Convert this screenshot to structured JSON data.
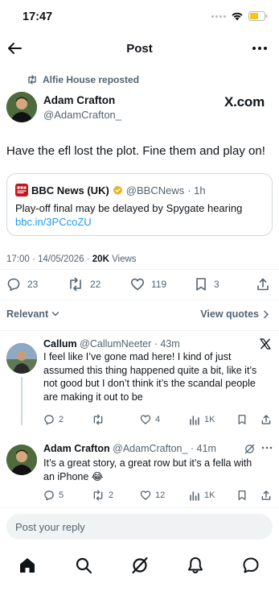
{
  "status_bar": {
    "time": "17:47"
  },
  "header": {
    "title": "Post"
  },
  "post": {
    "reposted_by": "Alfie House reposted",
    "author_name": "Adam Crafton",
    "author_handle": "@AdamCrafton_",
    "source_logo": "X.com",
    "text": "Have the efl lost the plot. Fine them and play on!",
    "quote": {
      "name": "BBC News (UK)",
      "handle": "@BBCNews",
      "time": "· 1h",
      "text": "Play-off final may be delayed by Spygate hearing",
      "link": "bbc.in/3PCcoZU"
    },
    "timestamp": "17:00 · 14/05/2026 · ",
    "views_count": "20K",
    "views_label": " Views",
    "stats": {
      "replies": "23",
      "reposts": "22",
      "likes": "119",
      "bookmarks": "3"
    }
  },
  "sort": {
    "label": "Relevant",
    "view_quotes": "View quotes"
  },
  "replies": [
    {
      "name": "Callum",
      "handle": "@CallumNeeter",
      "time": "· 43m",
      "text": "I feel like I’ve gone mad here! I kind of just assumed this thing happened quite a bit, like it’s not good but I don’t think it’s the scandal people are making it out to be",
      "replies": "2",
      "reposts": "",
      "likes": "4",
      "views": "1K"
    },
    {
      "name": "Adam Crafton",
      "handle": "@AdamCrafton_",
      "time": "· 41m",
      "text": "It’s a great story, a great row but it’s a fella with an iPhone 😂",
      "replies": "5",
      "reposts": "2",
      "likes": "12",
      "views": "1K"
    }
  ],
  "reply_bar": {
    "placeholder": "Post your reply"
  },
  "icons": [
    "back-arrow-icon",
    "more-icon",
    "repost-icon",
    "reply-icon",
    "like-icon",
    "bookmark-icon",
    "share-icon",
    "views-icon",
    "home-icon",
    "search-icon",
    "grok-icon",
    "notifications-icon",
    "messages-icon",
    "x-logo-icon"
  ],
  "colors": {
    "accent": "#1d9bf0",
    "text": "#0f1419",
    "muted": "#536471",
    "battery": "#f5c518",
    "bbc_red": "#c4161c"
  }
}
